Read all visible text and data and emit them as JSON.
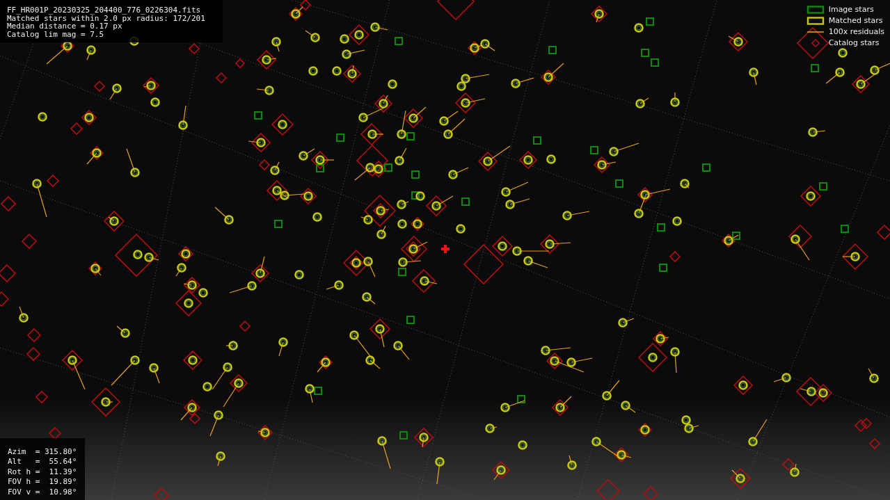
{
  "info_lines": [
    "FF_HR001P_20230325_204400_776_0226304.fits",
    "Matched stars within 2.0 px radius: 172/201",
    "Median distance = 0.17 px",
    "Catalog lim mag = 7.5"
  ],
  "legend": [
    {
      "kind": "image",
      "label": "Image stars"
    },
    {
      "kind": "matched",
      "label": "Matched stars"
    },
    {
      "kind": "residual",
      "label": "100x residuals"
    },
    {
      "kind": "catalog",
      "label": "Catalog stars"
    }
  ],
  "pointing_lines": [
    "Azim  = 315.80°",
    "Alt   =  55.64°",
    "Rot h =  11.39°",
    "FOV h =  19.89°",
    "FOV v =  10.98°"
  ]
}
